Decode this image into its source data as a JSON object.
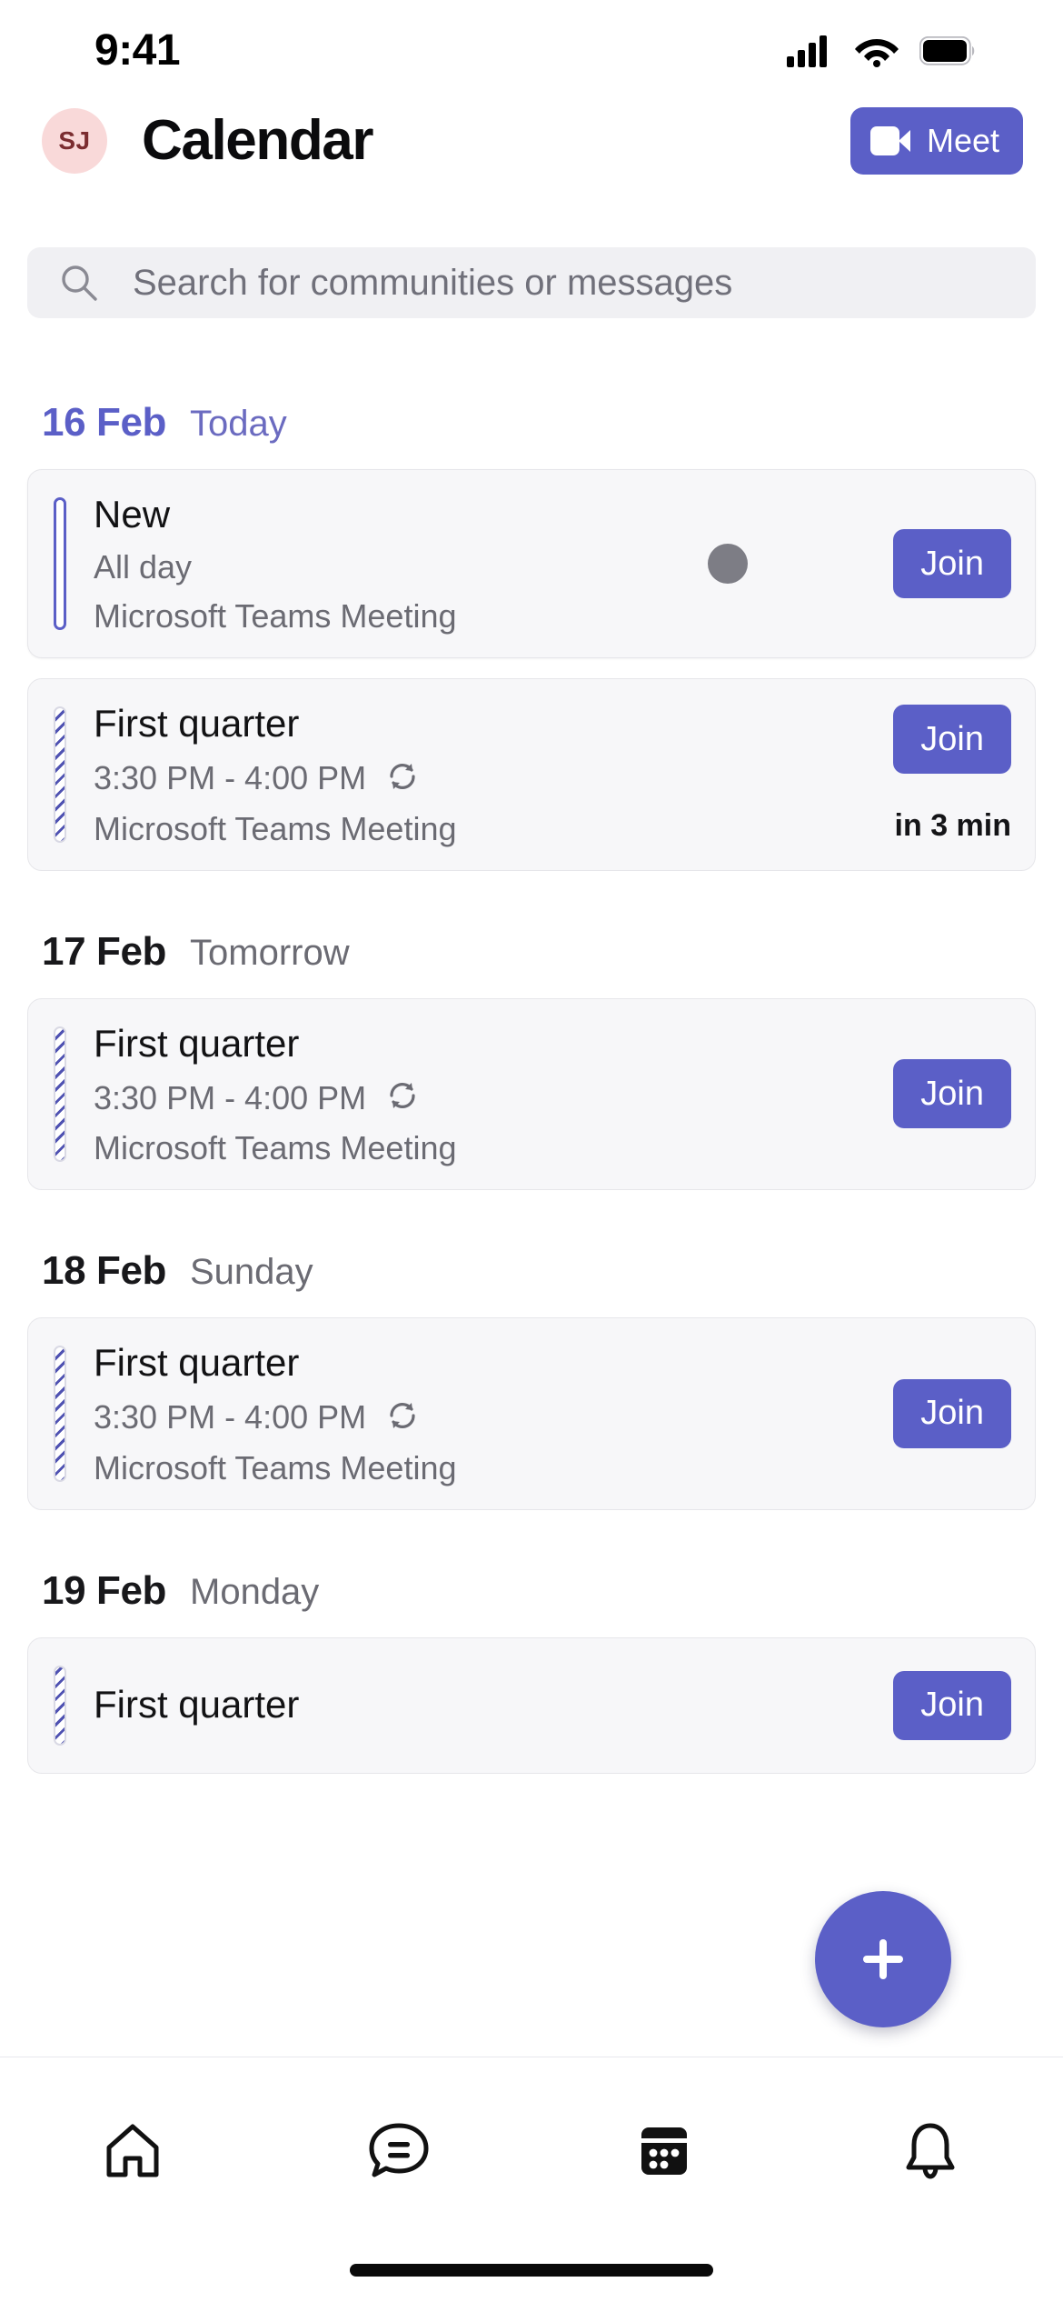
{
  "status_bar": {
    "time": "9:41",
    "icons": [
      "cellular-signal-icon",
      "wifi-icon",
      "battery-icon"
    ]
  },
  "header": {
    "avatar_initials": "SJ",
    "title": "Calendar",
    "meet_label": "Meet",
    "meet_icon": "video-camera-icon",
    "accent_color": "#5B5FC7",
    "avatar_bg": "#F9D9D9"
  },
  "search": {
    "placeholder": "Search for communities or messages",
    "icon": "search-icon"
  },
  "days": [
    {
      "date": "16 Feb",
      "relative": "Today",
      "is_today": true,
      "events": [
        {
          "title": "New",
          "time": "All day",
          "subtitle": "Microsoft Teams Meeting",
          "bar_style": "solid",
          "join_label": "Join",
          "recurring": false,
          "has_status_dot": true,
          "status_dot_color": "#7D7D85",
          "soon": ""
        },
        {
          "title": "First quarter",
          "time": "3:30 PM - 4:00 PM",
          "subtitle": "Microsoft Teams Meeting",
          "bar_style": "striped",
          "join_label": "Join",
          "recurring": true,
          "has_status_dot": false,
          "soon": "in 3 min"
        }
      ]
    },
    {
      "date": "17 Feb",
      "relative": "Tomorrow",
      "is_today": false,
      "events": [
        {
          "title": "First quarter",
          "time": "3:30 PM - 4:00 PM",
          "subtitle": "Microsoft Teams Meeting",
          "bar_style": "striped",
          "join_label": "Join",
          "recurring": true,
          "has_status_dot": false,
          "soon": ""
        }
      ]
    },
    {
      "date": "18 Feb",
      "relative": "Sunday",
      "is_today": false,
      "events": [
        {
          "title": "First quarter",
          "time": "3:30 PM - 4:00 PM",
          "subtitle": "Microsoft Teams Meeting",
          "bar_style": "striped",
          "join_label": "Join",
          "recurring": true,
          "has_status_dot": false,
          "soon": ""
        }
      ]
    },
    {
      "date": "19 Feb",
      "relative": "Monday",
      "is_today": false,
      "events": [
        {
          "title": "First quarter",
          "time": "",
          "subtitle": "",
          "bar_style": "striped",
          "join_label": "Join",
          "recurring": false,
          "has_status_dot": false,
          "soon": ""
        }
      ]
    }
  ],
  "fab": {
    "icon": "plus-icon",
    "color": "#5B5FC7"
  },
  "bottom_nav": {
    "items": [
      {
        "icon": "home-icon",
        "active": false
      },
      {
        "icon": "chat-icon",
        "active": false
      },
      {
        "icon": "calendar-icon",
        "active": true
      },
      {
        "icon": "bell-icon",
        "active": false
      }
    ]
  }
}
